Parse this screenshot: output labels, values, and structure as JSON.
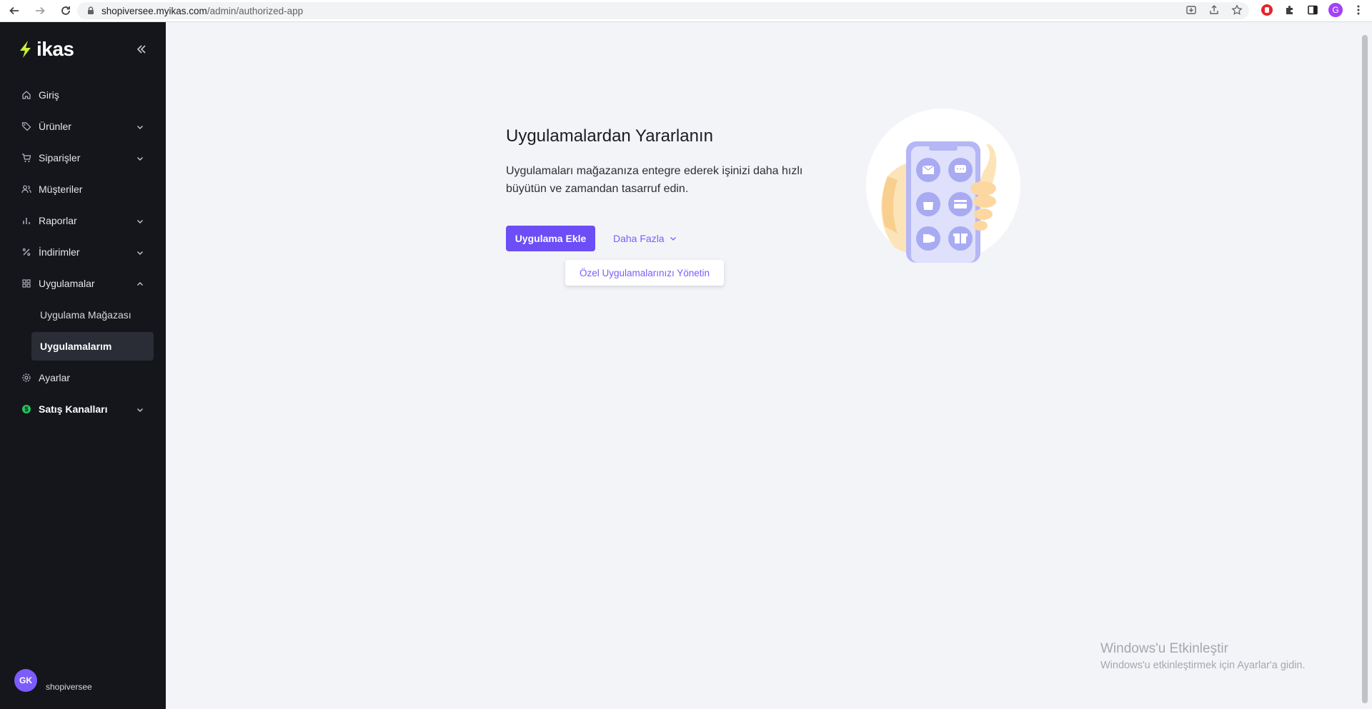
{
  "browser": {
    "url_host": "shopiversee.myikas.com",
    "url_path": "/admin/authorized-app",
    "profile_initial": "G"
  },
  "sidebar": {
    "logo_text": "ikas",
    "items": [
      {
        "label": "Giriş",
        "icon": "home-icon"
      },
      {
        "label": "Ürünler",
        "icon": "tag-icon"
      },
      {
        "label": "Siparişler",
        "icon": "cart-icon"
      },
      {
        "label": "Müşteriler",
        "icon": "users-icon"
      },
      {
        "label": "Raporlar",
        "icon": "chart-icon"
      },
      {
        "label": "İndirimler",
        "icon": "percent-icon"
      },
      {
        "label": "Uygulamalar",
        "icon": "apps-icon"
      },
      {
        "label": "Ayarlar",
        "icon": "gear-icon"
      },
      {
        "label": "Satış Kanalları",
        "icon": "dollar-icon"
      }
    ],
    "sub_items": [
      {
        "label": "Uygulama Mağazası"
      },
      {
        "label": "Uygulamalarım"
      }
    ],
    "user": {
      "initials": "GK",
      "name": "shopiversee"
    }
  },
  "main": {
    "title": "Uygulamalardan Yararlanın",
    "description": "Uygulamaları mağazanıza entegre ederek işinizi daha hızlı büyütün ve zamandan tasarruf edin.",
    "primary_button": "Uygulama Ekle",
    "more_button": "Daha Fazla",
    "dropdown_item": "Özel Uygulamalarınızı Yönetin"
  },
  "watermark": {
    "title": "Windows'u Etkinleştir",
    "subtitle": "Windows'u etkinleştirmek için Ayarlar'a gidin."
  },
  "colors": {
    "accent": "#6c4df6",
    "sidebar_bg": "#15161b",
    "logo_green": "#c6f03d"
  }
}
